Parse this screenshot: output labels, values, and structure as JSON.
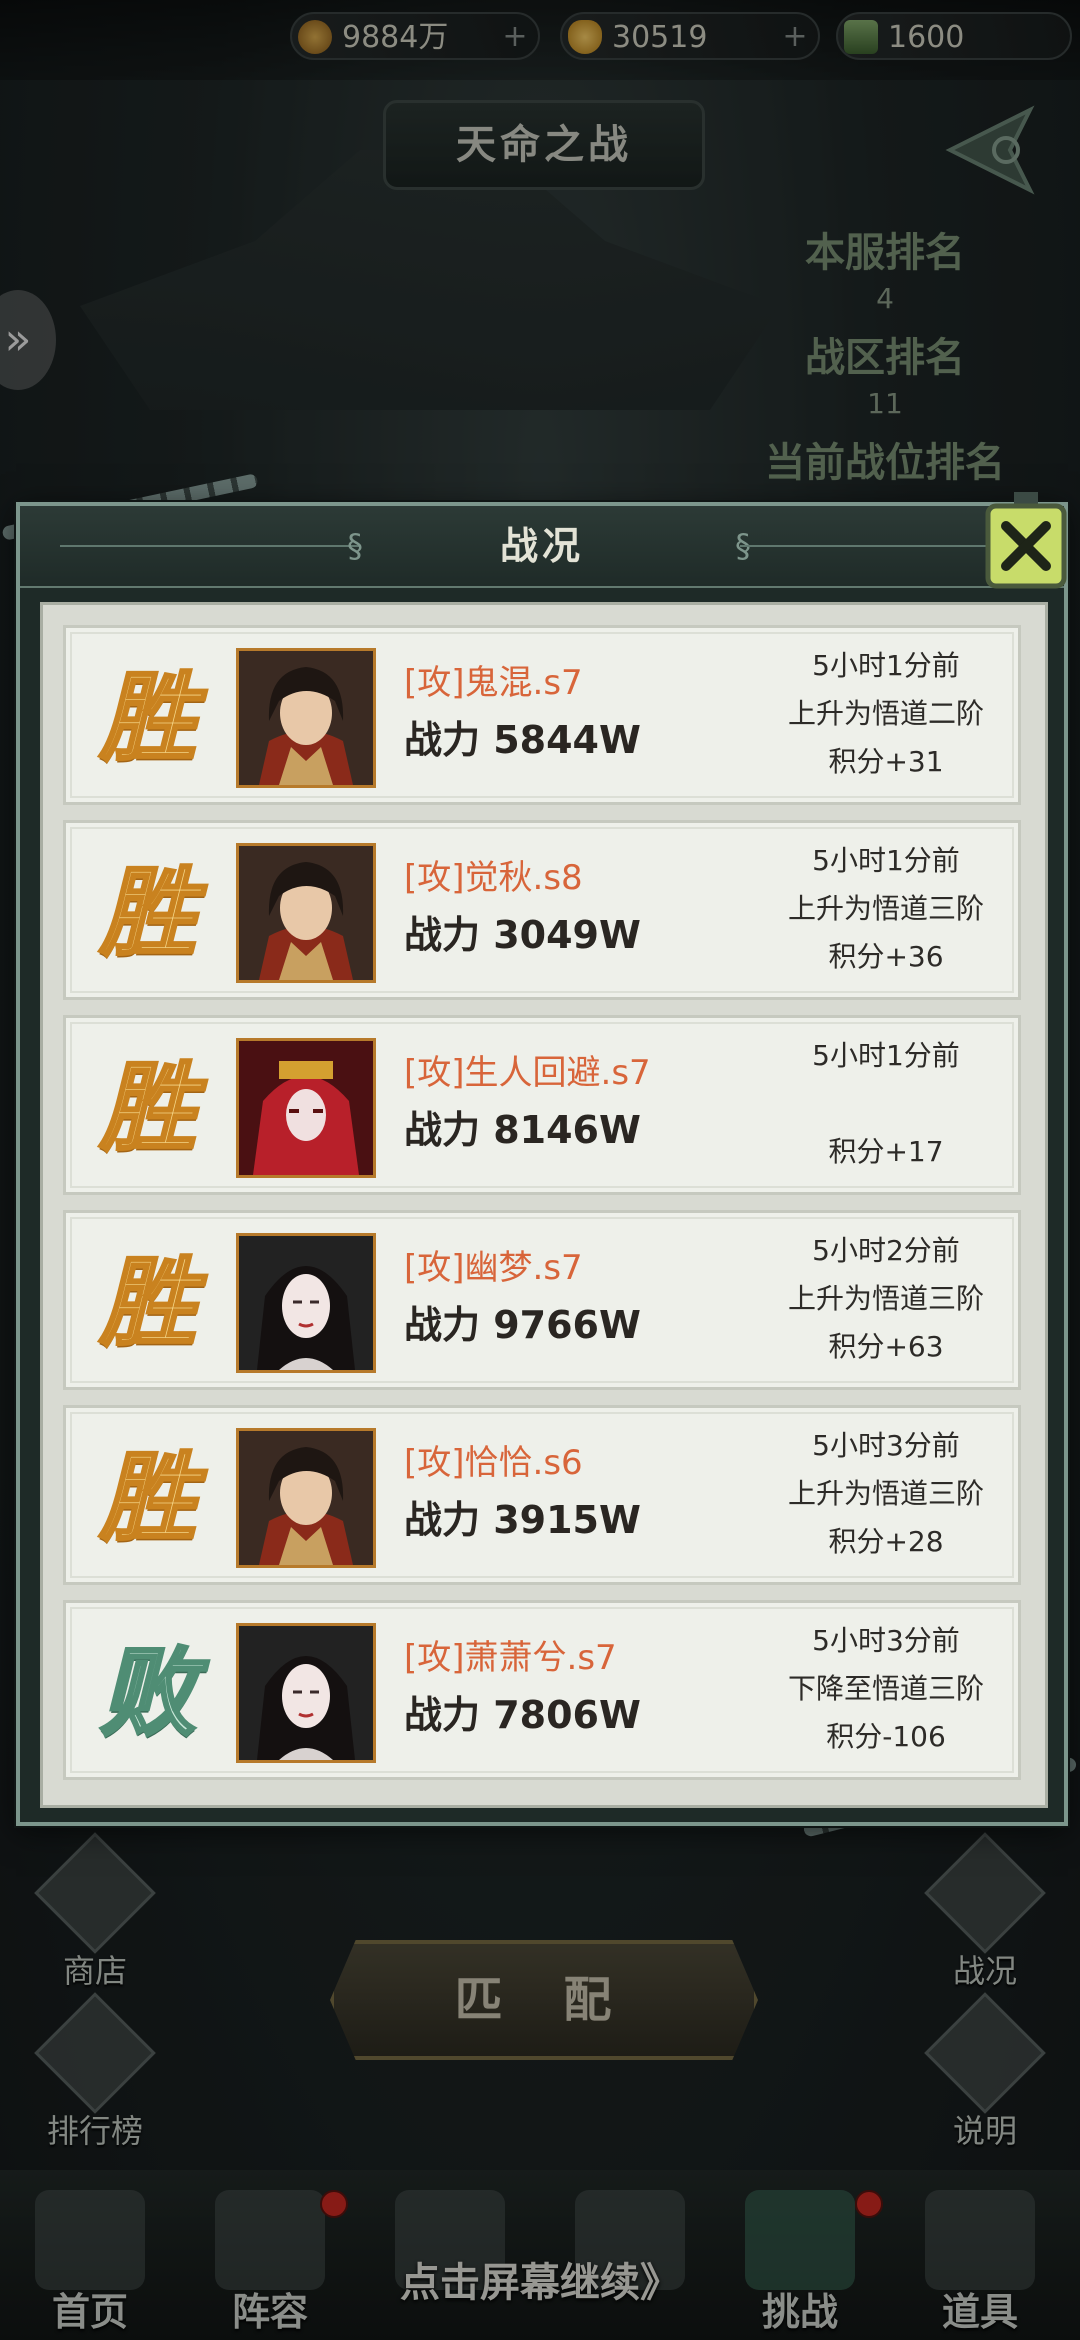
{
  "resources": [
    {
      "value": "9884万",
      "icon": "coin-icon",
      "color": "#b8842e"
    },
    {
      "value": "30519",
      "icon": "gold-ingot-icon",
      "color": "#d9a640"
    },
    {
      "value": "1600",
      "icon": "jade-token-icon",
      "color": "#6f9a5b"
    }
  ],
  "header": {
    "title": "天命之战"
  },
  "ranking": {
    "server_label": "本服排名",
    "server_value": "4",
    "zone_label": "战区排名",
    "zone_value": "11",
    "current_label": "当前战位排名"
  },
  "dialog": {
    "title": "战况",
    "rows": [
      {
        "result": "胜",
        "result_type": "win",
        "name": "[攻]鬼混.s7",
        "power": "战力 5844W",
        "time": "5小时1分前",
        "change": "上升为悟道二阶",
        "points": "积分+31",
        "avatar": "male-warrior"
      },
      {
        "result": "胜",
        "result_type": "win",
        "name": "[攻]觉秋.s8",
        "power": "战力 3049W",
        "time": "5小时1分前",
        "change": "上升为悟道三阶",
        "points": "积分+36",
        "avatar": "male-warrior"
      },
      {
        "result": "胜",
        "result_type": "win",
        "name": "[攻]生人回避.s7",
        "power": "战力 8146W",
        "time": "5小时1分前",
        "change": "",
        "points": "积分+17",
        "avatar": "red-veiled"
      },
      {
        "result": "胜",
        "result_type": "win",
        "name": "[攻]幽梦.s7",
        "power": "战力 9766W",
        "time": "5小时2分前",
        "change": "上升为悟道三阶",
        "points": "积分+63",
        "avatar": "female-ghost"
      },
      {
        "result": "胜",
        "result_type": "win",
        "name": "[攻]恰恰.s6",
        "power": "战力 3915W",
        "time": "5小时3分前",
        "change": "上升为悟道三阶",
        "points": "积分+28",
        "avatar": "male-warrior"
      },
      {
        "result": "败",
        "result_type": "lose",
        "name": "[攻]萧萧兮.s7",
        "power": "战力 7806W",
        "time": "5小时3分前",
        "change": "下降至悟道三阶",
        "points": "积分-106",
        "avatar": "female-ghost"
      }
    ]
  },
  "side_menu": {
    "shop": "商店",
    "leaderboard": "排行榜",
    "battle_report": "战况",
    "help": "说明"
  },
  "match_button": "匹 配",
  "bottom_nav": [
    {
      "label": "首页",
      "badge": false
    },
    {
      "label": "阵容",
      "badge": true
    },
    {
      "label": "",
      "badge": false
    },
    {
      "label": "",
      "badge": false
    },
    {
      "label": "挑战",
      "badge": true
    },
    {
      "label": "道具",
      "badge": false
    }
  ],
  "continue_hint": "点击屏幕继续》"
}
